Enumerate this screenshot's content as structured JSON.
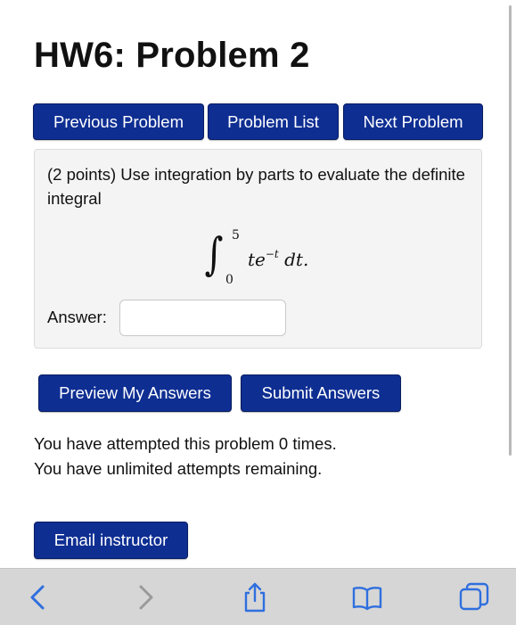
{
  "page": {
    "title": "HW6: Problem 2"
  },
  "nav": {
    "previous_label": "Previous Problem",
    "list_label": "Problem List",
    "next_label": "Next Problem"
  },
  "problem": {
    "text": "(2 points) Use integration by parts to evaluate the definite integral",
    "integral": {
      "upper_limit": "5",
      "lower_limit": "0",
      "integrand_base": "te",
      "exponent": "−t",
      "differential": " dt."
    },
    "answer_label": "Answer:",
    "answer_value": ""
  },
  "actions": {
    "preview_label": "Preview My Answers",
    "submit_label": "Submit Answers"
  },
  "status": {
    "attempts_line": "You have attempted this problem 0 times.",
    "remaining_line": "You have unlimited attempts remaining."
  },
  "email": {
    "label": "Email instructor"
  },
  "toolbar": {
    "icons": [
      "back-icon",
      "forward-icon",
      "share-icon",
      "bookmarks-icon",
      "tabs-icon"
    ],
    "accent_color": "#2f6fde",
    "disabled_color": "#9a9a9a"
  },
  "colors": {
    "button_bg": "#0e2e92",
    "panel_bg": "#f4f4f4"
  }
}
